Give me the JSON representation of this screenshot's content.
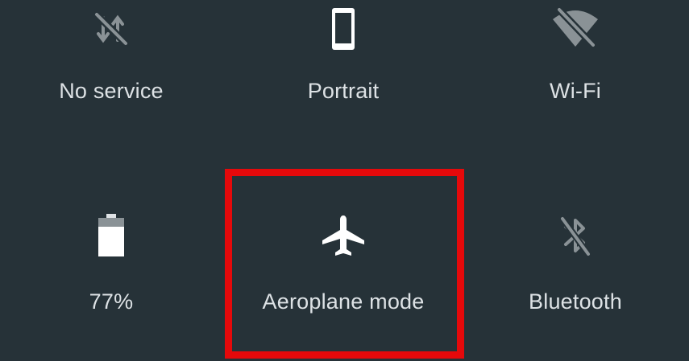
{
  "quick_settings": {
    "tiles": [
      {
        "id": "no_service",
        "label": "No service",
        "icon": "no-signal-icon",
        "state": "off"
      },
      {
        "id": "portrait",
        "label": "Portrait",
        "icon": "phone-portrait-icon",
        "state": "on"
      },
      {
        "id": "wifi",
        "label": "Wi-Fi",
        "icon": "wifi-off-icon",
        "state": "off"
      },
      {
        "id": "battery",
        "label": "77%",
        "icon": "battery-icon",
        "state": "on",
        "level_percent": 77
      },
      {
        "id": "aeroplane",
        "label": "Aeroplane mode",
        "icon": "airplane-icon",
        "state": "on",
        "highlighted": true
      },
      {
        "id": "bluetooth",
        "label": "Bluetooth",
        "icon": "bluetooth-off-icon",
        "state": "off"
      }
    ]
  },
  "colors": {
    "background": "#263238",
    "icon_on": "#ffffff",
    "icon_off": "#8a9296",
    "label": "#dde2e5",
    "highlight": "#e5090b"
  }
}
